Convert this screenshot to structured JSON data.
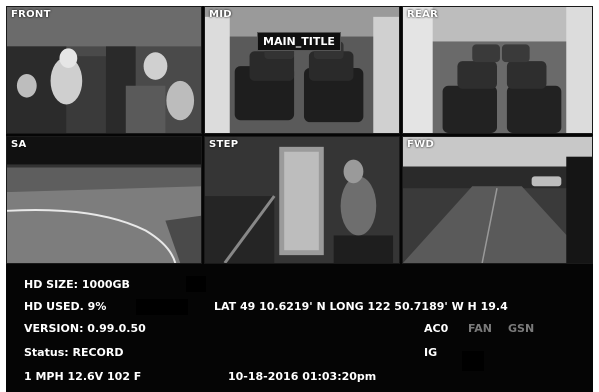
{
  "cameras": {
    "front": {
      "label": "FRONT"
    },
    "mid": {
      "label": "MID",
      "overlay": "MAIN_TITLE"
    },
    "rear": {
      "label": "REAR"
    },
    "sa": {
      "label": "SA"
    },
    "step": {
      "label": "STEP"
    },
    "fwd": {
      "label": "FWD"
    }
  },
  "status": {
    "hd_size": "HD SIZE: 1000GB",
    "hd_used": "HD USED. 9%",
    "version": "VERSION: 0.99.0.50",
    "status": "Status:  RECORD",
    "speed_line": "1 MPH     12.6V   102  F",
    "datetime": "10-18-2016  01:03:20pm",
    "gps": "LAT  49  10.6219'  N   LONG  122  50.7189'  W  H  19.4",
    "ac": "AC0",
    "fan": "FAN",
    "gsn": "GSN",
    "ig": "IG"
  }
}
